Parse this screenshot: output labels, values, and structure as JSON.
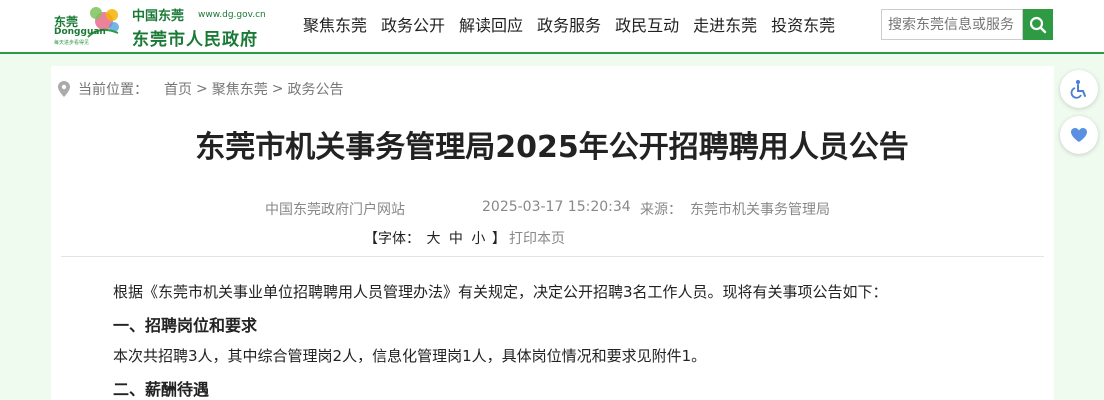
{
  "header": {
    "logo": {
      "city": "东莞",
      "city_en": "Dongguan",
      "tagline": "每天进步看得见",
      "calligraphy": "中国东莞",
      "url": "www.dg.gov.cn",
      "gov_name": "东莞市人民政府"
    },
    "nav": [
      "聚焦东莞",
      "政务公开",
      "解读回应",
      "政务服务",
      "政民互动",
      "走进东莞",
      "投资东莞"
    ],
    "search": {
      "placeholder": "搜索东莞信息或服务"
    }
  },
  "side_buttons": [
    "accessibility-icon",
    "heart-icon"
  ],
  "breadcrumb": {
    "label": "当前位置：",
    "items": [
      "首页",
      "聚焦东莞",
      "政务公告"
    ],
    "separator": ">"
  },
  "article": {
    "title": "东莞市机关事务管理局2025年公开招聘聘用人员公告",
    "site": "中国东莞政府门户网站",
    "datetime": "2025-03-17 15:20:34",
    "source_label": "来源：",
    "source": "东莞市机关事务管理局",
    "font_label": "【字体：",
    "font_sizes": [
      "大",
      "中",
      "小"
    ],
    "font_close": "】",
    "print": "打印本页",
    "paragraphs": [
      {
        "text": "根据《东莞市机关事业单位招聘聘用人员管理办法》有关规定，决定公开招聘3名工作人员。现将有关事项公告如下：",
        "heading": false
      },
      {
        "text": "一、招聘岗位和要求",
        "heading": true
      },
      {
        "text": "本次共招聘3人，其中综合管理岗2人，信息化管理岗1人，具体岗位情况和要求见附件1。",
        "heading": false
      },
      {
        "text": "二、薪酬待遇",
        "heading": true
      }
    ]
  },
  "colors": {
    "brand_green": "#2e9a44",
    "page_bg": "#f0fbf0"
  }
}
